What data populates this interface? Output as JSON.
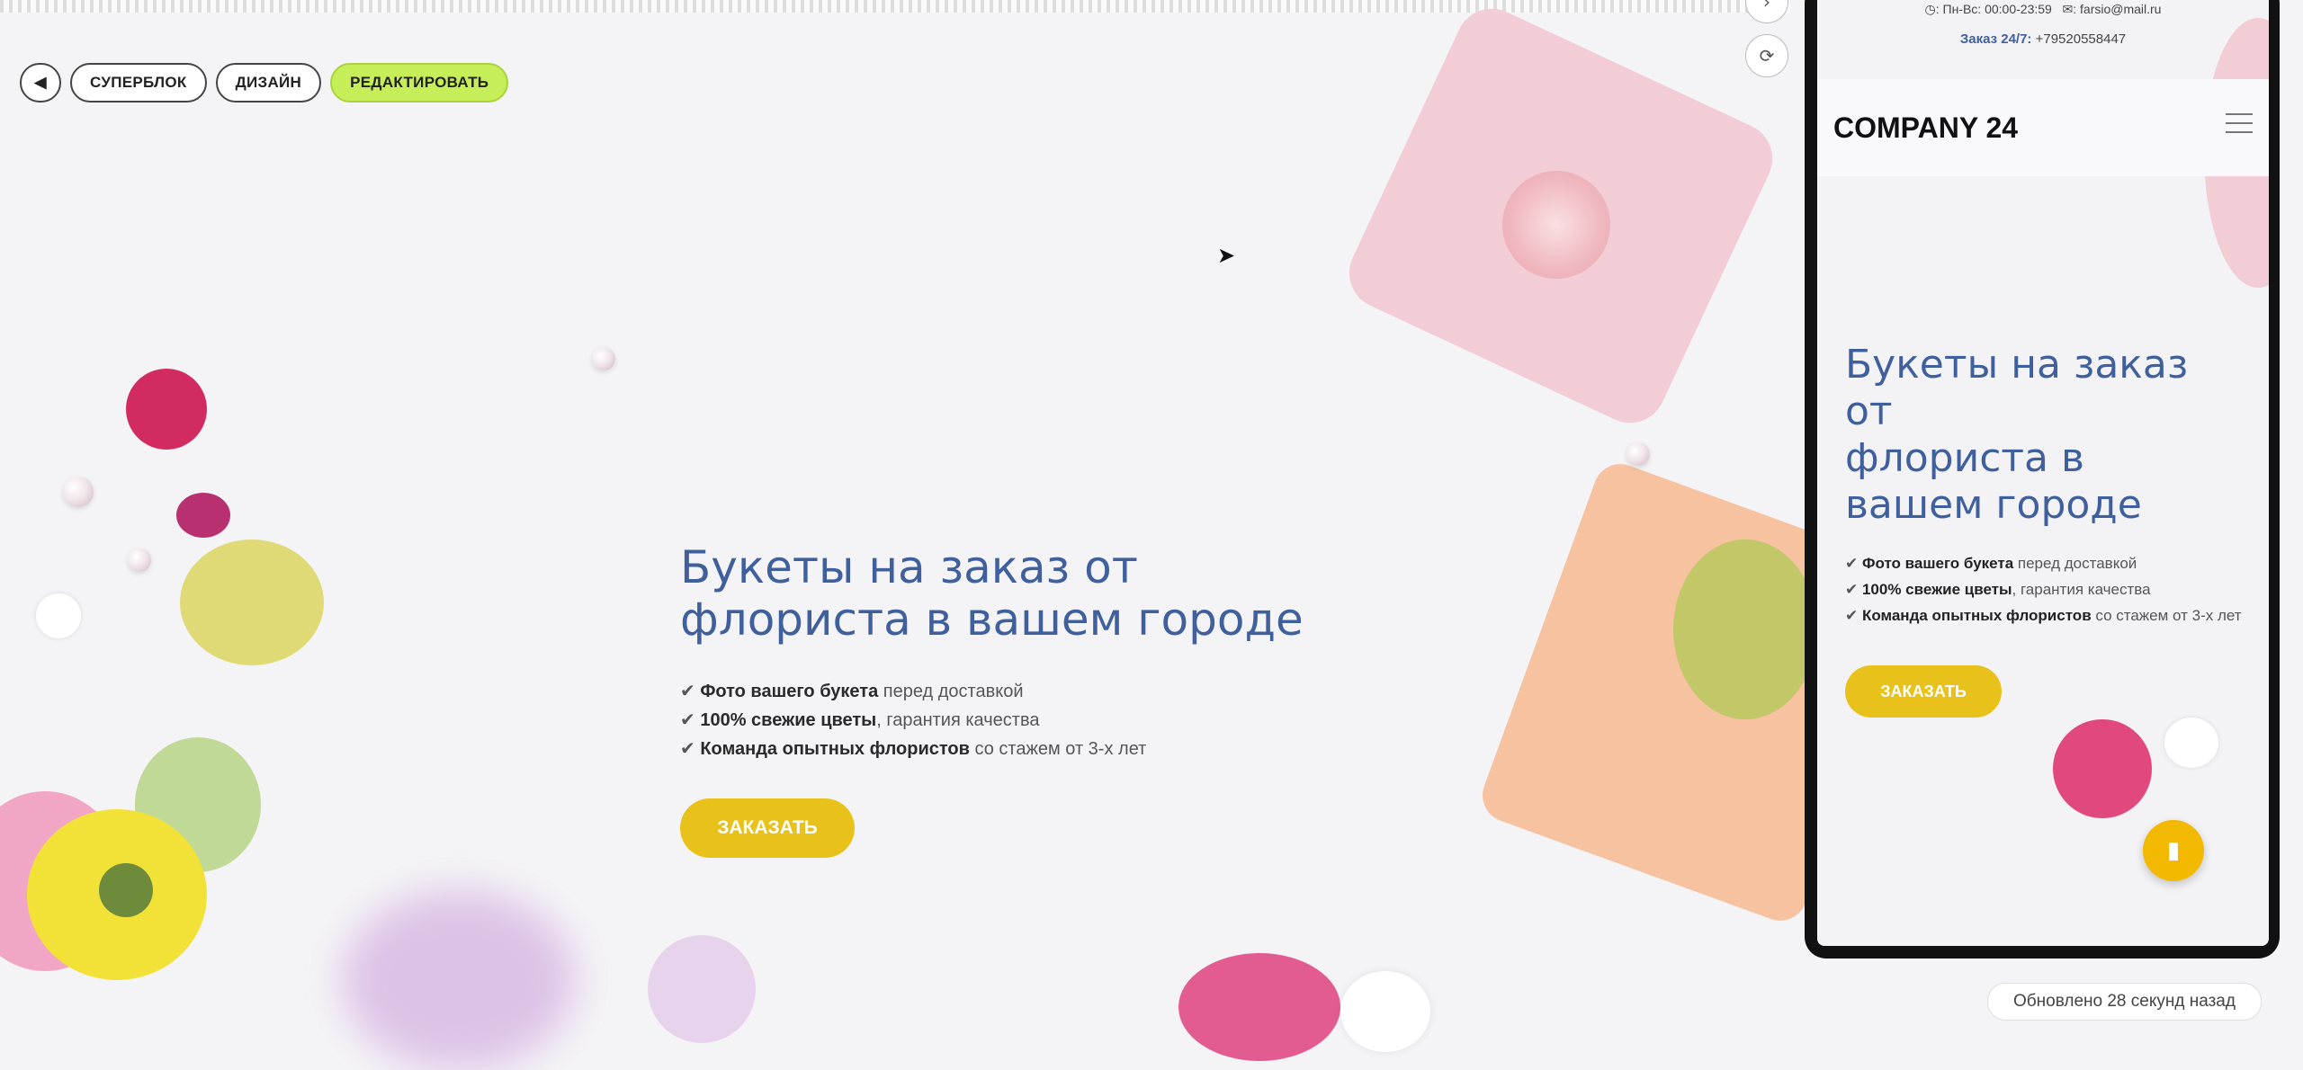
{
  "toolbar": {
    "back_icon": "triangle-left-icon",
    "superblock_label": "СУПЕРБЛОК",
    "design_label": "ДИЗАЙН",
    "edit_label": "РЕДАКТИРОВАТЬ"
  },
  "hero": {
    "title_line1": "Букеты на заказ от",
    "title_line2": "флориста в вашем городе",
    "features": [
      {
        "bold": "Фото вашего букета",
        "rest": " перед доставкой"
      },
      {
        "bold": "100% свежие цветы",
        "rest": ", гарантия качества"
      },
      {
        "bold": "Команда опытных флористов",
        "rest": " со стажем от 3-х лет"
      }
    ],
    "order_label": "ЗАКАЗАТЬ"
  },
  "mobile": {
    "hours": "Пн-Вс: 00:00-23:59",
    "email": "farsio@mail.ru",
    "order_prefix": "Заказ 24/7:",
    "phone": "+79520558447",
    "logo": "COMPANY 24",
    "title_line1": "Букеты на заказ",
    "title_line2": "от",
    "title_line3": "флориста в",
    "title_line4": "вашем городе",
    "features": [
      {
        "bold": "Фото вашего букета",
        "rest": " перед доставкой"
      },
      {
        "bold": "100% свежие цветы",
        "rest": ", гарантия качества"
      },
      {
        "bold": "Команда опытных флористов",
        "rest": " со стажем от 3-х лет"
      }
    ],
    "order_label": "ЗАКАЗАТЬ"
  },
  "status": {
    "updated": "Обновлено 28 секунд назад"
  },
  "colors": {
    "accent_title": "#3f5f9d",
    "order_button": "#e8c21b",
    "edit_button": "#c6ee58"
  }
}
